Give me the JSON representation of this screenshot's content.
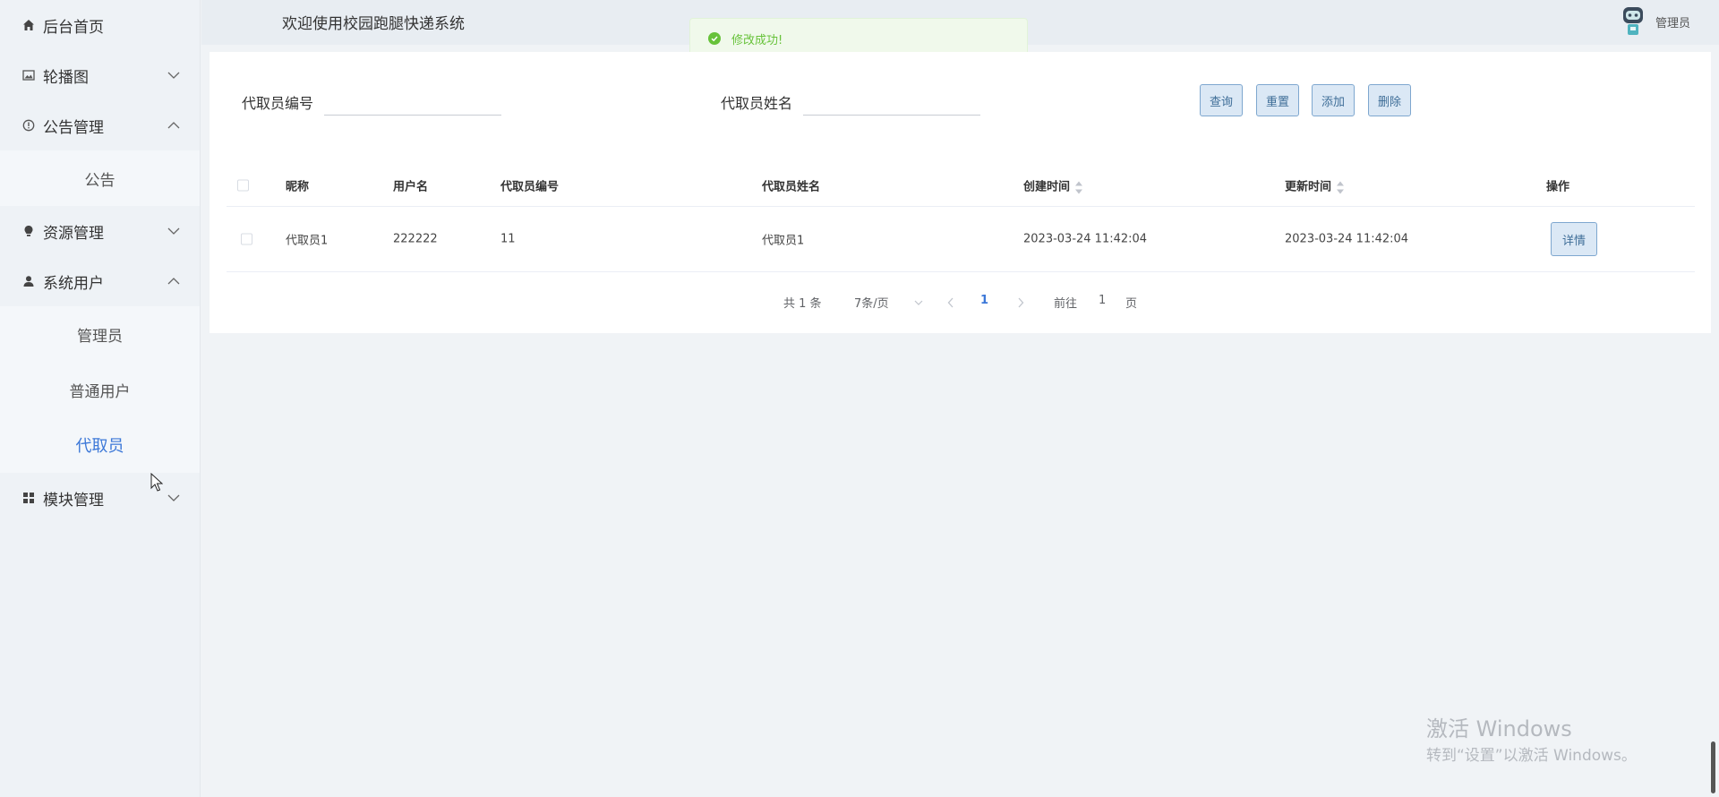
{
  "sidebar": {
    "items": [
      {
        "label": "后台首页",
        "icon": "home-icon"
      },
      {
        "label": "轮播图",
        "icon": "image-icon"
      },
      {
        "label": "公告管理",
        "icon": "info-icon"
      },
      {
        "label": "资源管理",
        "icon": "bulb-icon"
      },
      {
        "label": "系统用户",
        "icon": "user-icon"
      },
      {
        "label": "模块管理",
        "icon": "grid-icon"
      }
    ],
    "notice_sub": [
      "公告"
    ],
    "user_sub": [
      "管理员",
      "普通用户",
      "代取员"
    ],
    "active_sub": "代取员"
  },
  "header": {
    "title": "欢迎使用校园跑腿快递系统",
    "user": "管理员"
  },
  "toast": {
    "text": "修改成功!",
    "color": "#67c23a"
  },
  "search": {
    "label1": "代取员编号",
    "value1": "",
    "label2": "代取员姓名",
    "value2": ""
  },
  "buttons": {
    "query": "查询",
    "reset": "重置",
    "add": "添加",
    "delete": "删除"
  },
  "table": {
    "headers": [
      "昵称",
      "用户名",
      "代取员编号",
      "代取员姓名",
      "创建时间",
      "更新时间",
      "操作"
    ],
    "rows": [
      {
        "nickname": "代取员1",
        "username": "222222",
        "code": "11",
        "name": "代取员1",
        "created": "2023-03-24 11:42:04",
        "updated": "2023-03-24 11:42:04",
        "action": "详情"
      }
    ]
  },
  "pagination": {
    "total": "共 1 条",
    "page_size": "7条/页",
    "current": "1",
    "goto_prefix": "前往",
    "goto_value": "1",
    "goto_suffix": "页"
  },
  "watermark": {
    "line1": "激活 Windows",
    "line2": "转到“设置”以激活 Windows。"
  },
  "colors": {
    "accent": "#3c78d8",
    "button_bg": "#dbe8f5",
    "button_border": "#7ea7cf",
    "success": "#67c23a"
  }
}
